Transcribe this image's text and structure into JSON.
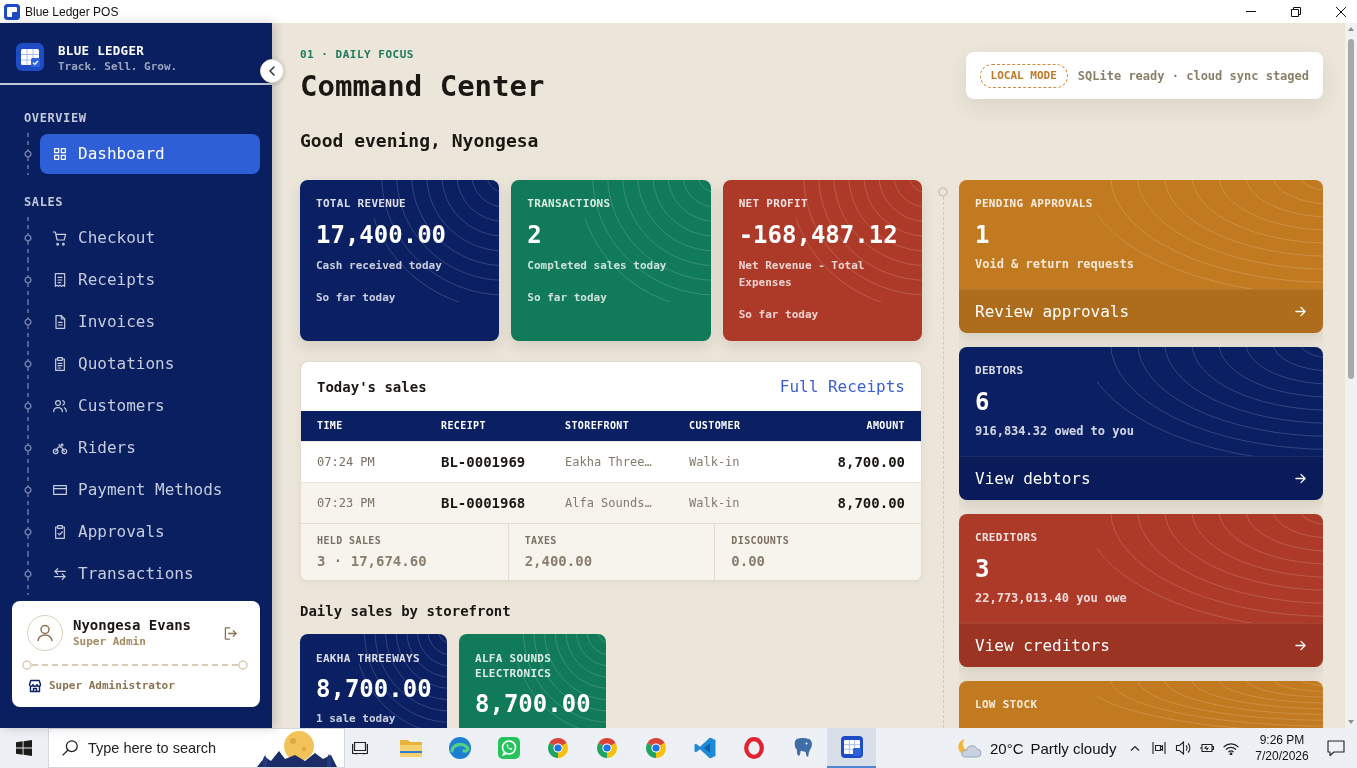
{
  "window": {
    "title": "Blue Ledger POS"
  },
  "sidebar": {
    "brand": {
      "name": "BLUE LEDGER",
      "tagline": "Track. Sell. Grow."
    },
    "sections": [
      {
        "title": "OVERVIEW",
        "items": [
          {
            "label": "Dashboard",
            "kind": "grid",
            "selected": true
          }
        ]
      },
      {
        "title": "SALES",
        "items": [
          {
            "label": "Checkout",
            "kind": "cart",
            "selected": false
          },
          {
            "label": "Receipts",
            "kind": "receipt",
            "selected": false
          },
          {
            "label": "Invoices",
            "kind": "document",
            "selected": false
          },
          {
            "label": "Quotations",
            "kind": "checklist",
            "selected": false
          },
          {
            "label": "Customers",
            "kind": "users",
            "selected": false
          },
          {
            "label": "Riders",
            "kind": "bicycle",
            "selected": false
          },
          {
            "label": "Payment Methods",
            "kind": "card",
            "selected": false
          },
          {
            "label": "Approvals",
            "kind": "clipboard",
            "selected": false
          },
          {
            "label": "Transactions",
            "kind": "transfer",
            "selected": false
          }
        ]
      }
    ],
    "user": {
      "name": "Nyongesa Evans",
      "role": "Super Admin",
      "access": "Super Administrator"
    }
  },
  "header": {
    "eyebrow": "01 · DAILY FOCUS",
    "title": "Command Center",
    "greeting": "Good evening, Nyongesa",
    "status": {
      "mode": "LOCAL MODE",
      "message": "SQLite ready · cloud sync staged"
    }
  },
  "stat_cards": [
    {
      "label": "TOTAL REVENUE",
      "value": "17,400.00",
      "note": "Cash received today",
      "period": "So far today",
      "color": "#0b1f63"
    },
    {
      "label": "TRANSACTIONS",
      "value": "2",
      "note": "Completed sales today",
      "period": "So far today",
      "color": "#117a59"
    },
    {
      "label": "NET PROFIT",
      "value": "-168,487.12",
      "note": "Net Revenue - Total Expenses",
      "period": "So far today",
      "color": "#ad3a28"
    }
  ],
  "sales_table": {
    "title": "Today's sales",
    "link": "Full Receipts",
    "columns": [
      "TIME",
      "RECEIPT",
      "STOREFRONT",
      "CUSTOMER",
      "AMOUNT"
    ],
    "rows": [
      {
        "cells": [
          "07:24 PM",
          "BL-0001969",
          "Eakha Three…",
          "Walk-in",
          "8,700.00"
        ]
      },
      {
        "cells": [
          "07:23 PM",
          "BL-0001968",
          "Alfa Sounds…",
          "Walk-in",
          "8,700.00"
        ]
      }
    ],
    "summary": [
      {
        "label": "HELD SALES",
        "value": "3 · 17,674.60"
      },
      {
        "label": "TAXES",
        "value": "2,400.00"
      },
      {
        "label": "DISCOUNTS",
        "value": "0.00"
      }
    ]
  },
  "storefronts": {
    "title": "Daily sales by storefront",
    "cards": [
      {
        "name": "EAKHA THREEWAYS",
        "value": "8,700.00",
        "note": "1 sale today",
        "color": "#0b1f63"
      },
      {
        "name": "ALFA SOUNDS ELECTRONICS",
        "value": "8,700.00",
        "color": "#117a59"
      }
    ]
  },
  "action_cards": [
    {
      "label": "PENDING APPROVALS",
      "value": "1",
      "note": "Void & return requests",
      "action": "Review approvals",
      "color": "#c27a20"
    },
    {
      "label": "DEBTORS",
      "value": "6",
      "note": "916,834.32 owed to you",
      "action": "View debtors",
      "color": "#0b1f63"
    },
    {
      "label": "CREDITORS",
      "value": "3",
      "note": "22,773,013.40 you owe",
      "action": "View creditors",
      "color": "#ad3a28"
    },
    {
      "label": "LOW STOCK",
      "color": "#c27a20"
    }
  ],
  "taskbar": {
    "search": {
      "placeholder": "Type here to search"
    },
    "apps": [
      {
        "kind": "folder",
        "selected": false
      },
      {
        "kind": "swirl",
        "selected": false
      },
      {
        "kind": "chat",
        "selected": false
      },
      {
        "kind": "ring",
        "selected": false
      },
      {
        "kind": "ring",
        "selected": false
      },
      {
        "kind": "ring",
        "selected": false
      },
      {
        "kind": "ribbon",
        "selected": false
      },
      {
        "kind": "oval",
        "selected": false
      },
      {
        "kind": "elephant",
        "selected": false
      },
      {
        "kind": "ledger",
        "selected": true
      }
    ],
    "weather": {
      "temperature": "20°C",
      "condition": "Partly cloudy"
    },
    "clock": {
      "time": "9:26 PM",
      "date": "7/20/2026"
    }
  }
}
